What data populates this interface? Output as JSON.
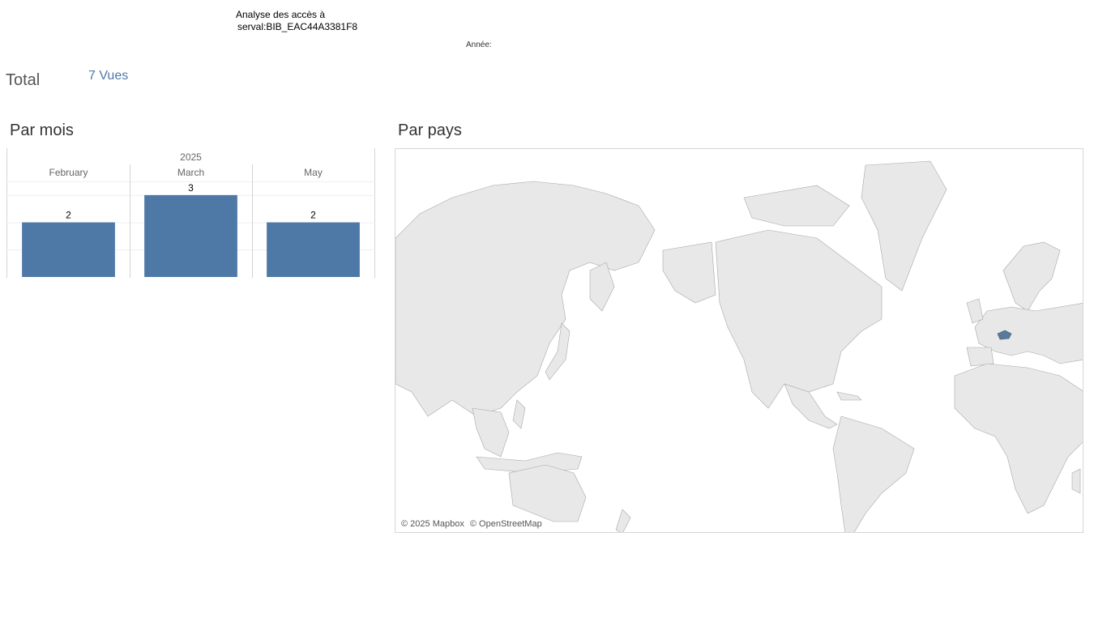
{
  "header": {
    "title_line1": "Analyse des accès à",
    "title_line2": "serval:BIB_EAC44A3381F8",
    "year_filter_label": "Année:"
  },
  "summary": {
    "total_label": "Total",
    "total_value": "7 Vues"
  },
  "sections": {
    "by_month_title": "Par mois",
    "by_country_title": "Par pays"
  },
  "chart_data": {
    "type": "bar",
    "title": "",
    "column_header": "2025",
    "categories": [
      "February",
      "March",
      "May"
    ],
    "values": [
      2,
      3,
      2
    ],
    "data_labels": [
      "2",
      "3",
      "2"
    ],
    "ylim": [
      0,
      3.5
    ],
    "bar_color": "#4e79a7",
    "grid": true
  },
  "map": {
    "highlighted_country": "Switzerland",
    "highlight_color": "#5a7a9a",
    "land_color": "#e6e6e6",
    "border_color": "#9a9a9a",
    "credit_mapbox": "© 2025 Mapbox",
    "credit_osm": "© OpenStreetMap"
  }
}
